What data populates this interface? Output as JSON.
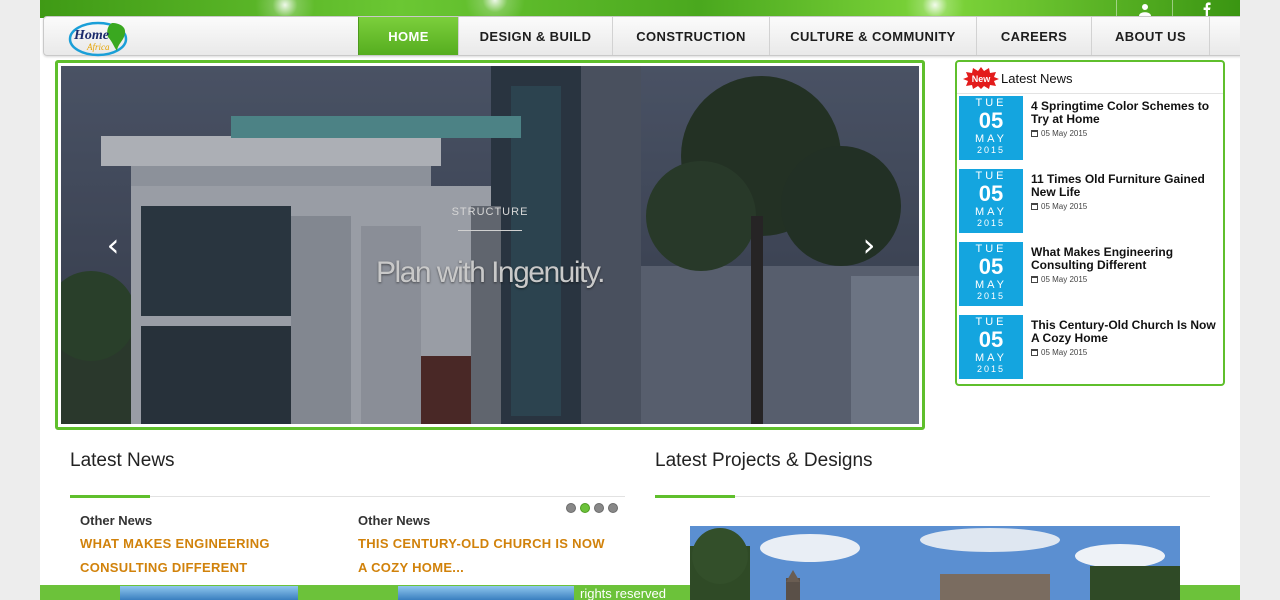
{
  "nav": {
    "logo_text_1": "Home",
    "logo_text_2": "Africa",
    "items": [
      {
        "label": "HOME",
        "active": true
      },
      {
        "label": "DESIGN & BUILD"
      },
      {
        "label": "CONSTRUCTION"
      },
      {
        "label": "CULTURE & COMMUNITY"
      },
      {
        "label": "CAREERS"
      },
      {
        "label": "ABOUT US"
      }
    ],
    "top_icons": [
      "user-icon",
      "facebook-icon"
    ]
  },
  "slider": {
    "tag": "STRUCTURE",
    "headline": "Plan with Ingenuity.",
    "prev": "‹",
    "next": "›"
  },
  "news_sidebar": {
    "badge": "New",
    "title": "Latest News",
    "items": [
      {
        "day": "TUE",
        "date": "05",
        "month": "MAY",
        "year": "2015",
        "title": "4 Springtime Color Schemes to Try at Home",
        "meta": "05 May 2015"
      },
      {
        "day": "TUE",
        "date": "05",
        "month": "MAY",
        "year": "2015",
        "title": "11 Times Old Furniture Gained New Life",
        "meta": "05 May 2015"
      },
      {
        "day": "TUE",
        "date": "05",
        "month": "MAY",
        "year": "2015",
        "title": "What Makes Engineering Consulting Different",
        "meta": "05 May 2015"
      },
      {
        "day": "TUE",
        "date": "05",
        "month": "MAY",
        "year": "2015",
        "title": "This Century-Old Church Is Now A Cozy Home",
        "meta": "05 May 2015"
      }
    ]
  },
  "latest_news": {
    "title": "Latest News",
    "columns": [
      {
        "label": "Other News",
        "link": "WHAT MAKES ENGINEERING CONSULTING DIFFERENT"
      },
      {
        "label": "Other News",
        "link": "THIS CENTURY-OLD CHURCH IS NOW A COZY HOME..."
      }
    ]
  },
  "projects": {
    "title": "Latest Projects & Designs"
  },
  "footer": {
    "text": "rights reserved"
  },
  "colors": {
    "accent_green": "#5fbf2c",
    "date_blue": "#14a5df",
    "link_orange": "#d1820b"
  }
}
